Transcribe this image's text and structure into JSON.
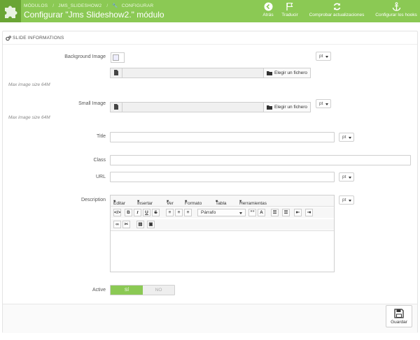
{
  "header": {
    "breadcrumb": [
      "MÓDULOS",
      "JMS_SLIDESHOW2",
      "CONFIGURAR"
    ],
    "title": "Configurar \"Jms Slideshow2.\" módulo",
    "toolbar": {
      "back": "Atrás",
      "translate": "Traducir",
      "check_updates": "Comprobar actualizaciones",
      "configure_hooks": "Configurar los hooks"
    }
  },
  "panel": {
    "heading": "SLIDE INFORMATIONS"
  },
  "form": {
    "background_image_label": "Background Image",
    "background_hint": "Max image size 64M",
    "small_image_label": "Small Image",
    "small_hint": "Max image size 64M",
    "choose_file": "Elegir un fichero",
    "title_label": "Title",
    "title_value": "",
    "class_label": "Class",
    "class_value": "",
    "url_label": "URL",
    "url_value": "",
    "description_label": "Description",
    "active_label": "Active",
    "switch_on": "SÍ",
    "switch_off": "NO",
    "lang": "pt"
  },
  "editor": {
    "menus": [
      "Editar",
      "Insertar",
      "Ver",
      "Formato",
      "Tabla",
      "Herramientas"
    ],
    "format_select": "Párrafo",
    "buttons_row1": [
      "</>",
      "B",
      "I",
      "U",
      "S"
    ],
    "buttons_row1b": [
      "””",
      "A"
    ]
  },
  "footer": {
    "save": "Guardar"
  },
  "colors": {
    "header_green": "#8bc954",
    "logo_green": "#6aa535"
  }
}
